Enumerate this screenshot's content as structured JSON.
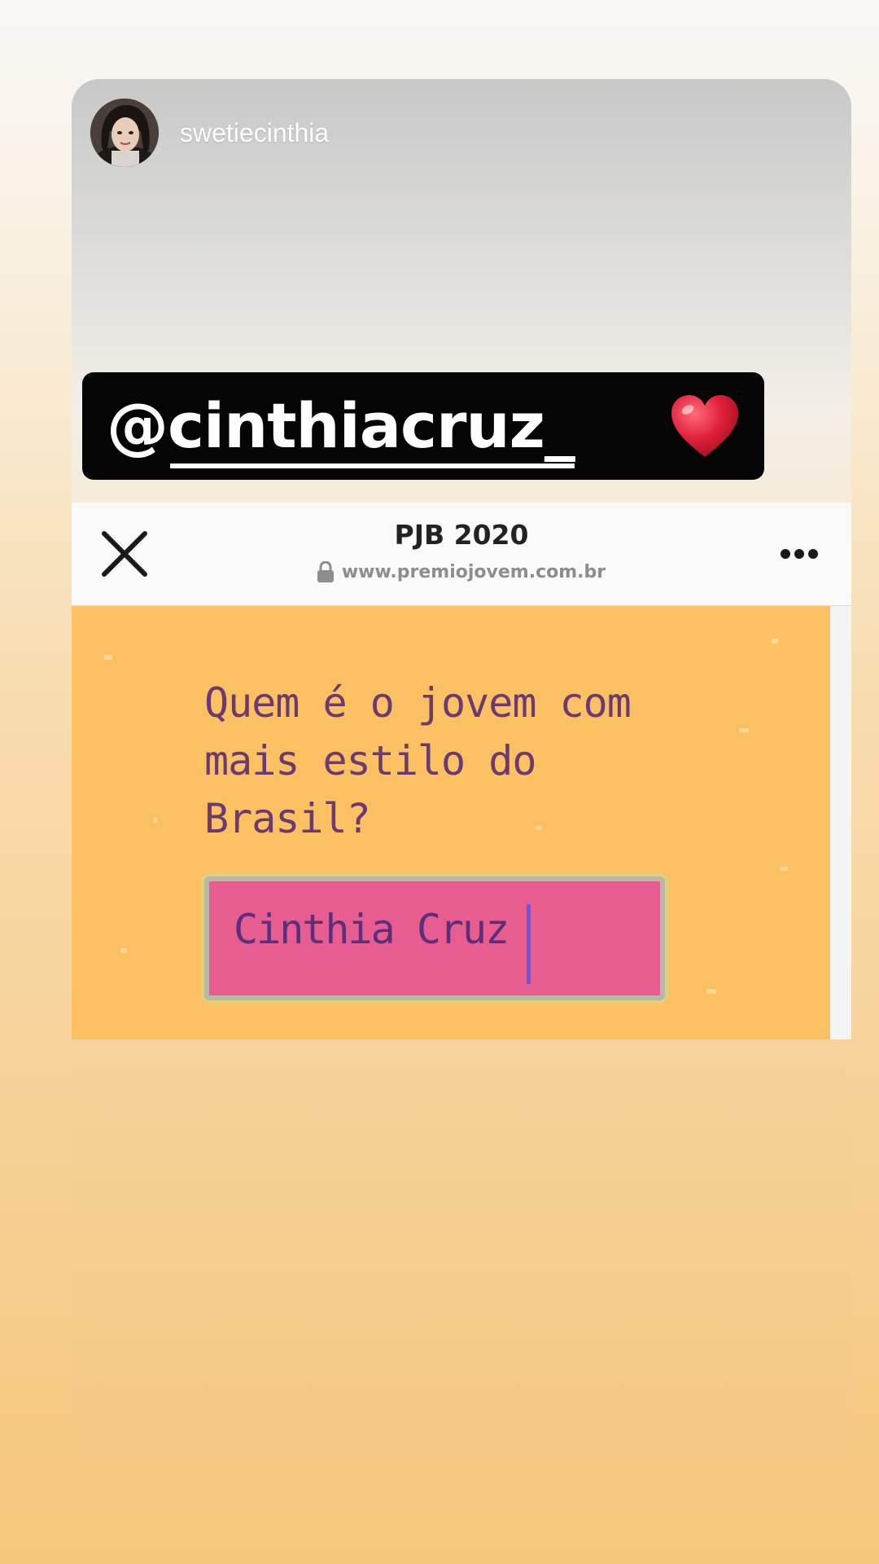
{
  "story": {
    "username": "swetiecinthia",
    "mention": "@cinthiacruz_",
    "sticker_emoji": "heart-icon"
  },
  "browser": {
    "title": "PJB 2020",
    "url": "www.premiojovem.com.br",
    "close_icon": "close-icon",
    "lock_icon": "lock-icon",
    "more_icon": "more-icon"
  },
  "web_page": {
    "question": "Quem é o jovem com mais estilo do Brasil?",
    "answer_value": "Cinthia Cruz"
  },
  "colors": {
    "page_background": "#fbc062",
    "answer_box": "#e85d90",
    "question_text": "#6a3a70",
    "sticker_background": "#050505",
    "heart": "#e0203a"
  }
}
